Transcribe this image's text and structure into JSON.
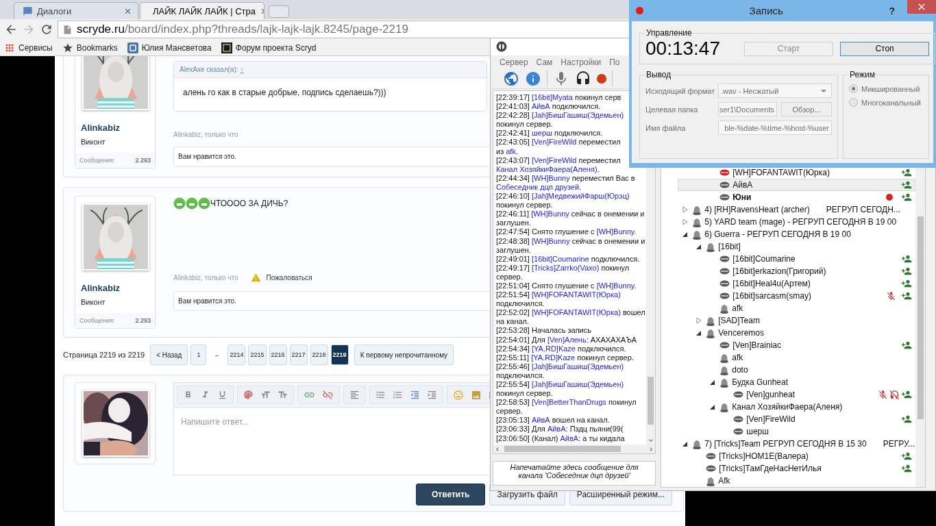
{
  "browser": {
    "tabs": [
      {
        "label": "Диалоги",
        "selected": false
      },
      {
        "label": "ЛАЙК ЛАЙК ЛАЙК | Стра",
        "selected": true
      }
    ],
    "address": {
      "host": "scryde.ru",
      "path": "/board/index.php?threads/lajk-lajk-lajk.8245/page-2219"
    },
    "bookmarks": [
      "Сервисы",
      "Bookmarks",
      "Юлия Мансветова",
      "Форум проекта Scryd"
    ]
  },
  "forum": {
    "posts": [
      {
        "author": "Alinkabiz",
        "rank": "Виконт",
        "stats_label": "Сообщения:",
        "stats_value": "2.293",
        "avatar": {
          "kind": "picture"
        },
        "quote": {
          "author": "AlexAxe сказал(а):",
          "link": "↑",
          "text": "алень го как в старые добрые, подпись сделаешь?)))"
        },
        "meta": "Alinkabiz, только что",
        "likes": "Вам нравится это."
      },
      {
        "author": "Alinkabiz",
        "rank": "Виконт",
        "stats_label": "Сообщения:",
        "stats_value": "2.293",
        "avatar": {
          "kind": "picture"
        },
        "text": "ЧТОООО ЗА ДИЧЬ?",
        "meta": "Alinkabiz, только что",
        "report": "Пожаловаться",
        "likes": "Вам нравится это."
      }
    ],
    "pagination": {
      "label": "Страница 2219 из 2219",
      "prev": "< Назад",
      "pages": [
        {
          "label": "1",
          "kind": "page",
          "selected": false
        },
        {
          "label": "←",
          "kind": "gap",
          "selected": false
        },
        {
          "label": "2214",
          "kind": "page",
          "selected": false
        },
        {
          "label": "2215",
          "kind": "page",
          "selected": false
        },
        {
          "label": "2216",
          "kind": "page",
          "selected": false
        },
        {
          "label": "2217",
          "kind": "page",
          "selected": false
        },
        {
          "label": "2218",
          "kind": "page",
          "selected": false
        },
        {
          "label": "2219",
          "kind": "page",
          "selected": true
        }
      ],
      "first_unread": "К первому непрочитанному"
    },
    "reply": {
      "avatar": {
        "kind": "picture"
      },
      "placeholder": "Напишите ответ...",
      "submit": "Ответить",
      "buttons": [
        "Загрузить файл",
        "Расширенный режим..."
      ]
    }
  },
  "teamspeak": {
    "menu": [
      "Сервер",
      "Сам",
      "Настройки",
      "По"
    ],
    "chat": {
      "lines": [
        {
          "parts": [
            {
              "kind": "time",
              "text": "[22:39:17] "
            },
            {
              "kind": "name",
              "text": "[16bit]Myata"
            },
            {
              "kind": "text",
              "text": " покинул серв"
            }
          ]
        },
        {
          "parts": [
            {
              "kind": "time",
              "text": "[22:41:03] "
            },
            {
              "kind": "name",
              "text": "АйвА"
            },
            {
              "kind": "text",
              "text": " подключился."
            }
          ]
        },
        {
          "parts": [
            {
              "kind": "time",
              "text": "[22:42:28] "
            },
            {
              "kind": "name",
              "text": "[Jah]БишГашиш(Эдемьен)"
            }
          ]
        },
        {
          "parts": [
            {
              "kind": "text",
              "text": "покинул сервер."
            }
          ]
        },
        {
          "parts": [
            {
              "kind": "time",
              "text": "[22:42:41] "
            },
            {
              "kind": "name",
              "text": "шерш"
            },
            {
              "kind": "text",
              "text": " подключился."
            }
          ]
        },
        {
          "parts": [
            {
              "kind": "time",
              "text": "[22:43:05] "
            },
            {
              "kind": "name",
              "text": "[Ven]FireWild"
            },
            {
              "kind": "text",
              "text": " переместил"
            }
          ]
        },
        {
          "parts": [
            {
              "kind": "text",
              "text": "из "
            },
            {
              "kind": "name",
              "text": "afk"
            },
            {
              "kind": "text",
              "text": "."
            }
          ]
        },
        {
          "parts": [
            {
              "kind": "time",
              "text": "[22:43:07] "
            },
            {
              "kind": "name",
              "text": "[Ven]FireWild"
            },
            {
              "kind": "text",
              "text": " переместил"
            }
          ]
        },
        {
          "parts": [
            {
              "kind": "name",
              "text": "Канал ХозяйкиФаера(Аленя)"
            },
            {
              "kind": "text",
              "text": "."
            }
          ]
        },
        {
          "parts": [
            {
              "kind": "time",
              "text": "[22:44:34] "
            },
            {
              "kind": "name",
              "text": "[WH]Bunny"
            },
            {
              "kind": "text",
              "text": " переместил Вас в"
            }
          ]
        },
        {
          "parts": [
            {
              "kind": "name",
              "text": "Собеседник дцп друзей"
            },
            {
              "kind": "text",
              "text": "."
            }
          ]
        },
        {
          "parts": [
            {
              "kind": "time",
              "text": "[22:46:10] "
            },
            {
              "kind": "name",
              "text": "[Jah]МедвежийФарш(Юрэц)"
            }
          ]
        },
        {
          "parts": [
            {
              "kind": "text",
              "text": "покинул сервер."
            }
          ]
        },
        {
          "parts": [
            {
              "kind": "time",
              "text": "[22:46:11] "
            },
            {
              "kind": "name",
              "text": "[WH]Bunny"
            },
            {
              "kind": "text",
              "text": " сейчас в онемении и"
            }
          ]
        },
        {
          "parts": [
            {
              "kind": "text",
              "text": "заглушен."
            }
          ]
        },
        {
          "parts": [
            {
              "kind": "time",
              "text": "[22:47:54] "
            },
            {
              "kind": "text",
              "text": "Снято глушение с "
            },
            {
              "kind": "name",
              "text": "[WH]Bunny"
            },
            {
              "kind": "text",
              "text": "."
            }
          ]
        },
        {
          "parts": [
            {
              "kind": "time",
              "text": "[22:48:38] "
            },
            {
              "kind": "name",
              "text": "[WH]Bunny"
            },
            {
              "kind": "text",
              "text": " сейчас в онемении и"
            }
          ]
        },
        {
          "parts": [
            {
              "kind": "text",
              "text": "заглушен."
            }
          ]
        },
        {
          "parts": [
            {
              "kind": "time",
              "text": "[22:49:01] "
            },
            {
              "kind": "name",
              "text": "[16bit]Coumarine"
            },
            {
              "kind": "text",
              "text": " подключился."
            }
          ]
        },
        {
          "parts": [
            {
              "kind": "time",
              "text": "[22:49:17] "
            },
            {
              "kind": "name",
              "text": "[Tricks]Zarrko(Vaxo)"
            },
            {
              "kind": "text",
              "text": " покинул"
            }
          ]
        },
        {
          "parts": [
            {
              "kind": "text",
              "text": "сервер."
            }
          ]
        },
        {
          "parts": [
            {
              "kind": "time",
              "text": "[22:51:04] "
            },
            {
              "kind": "text",
              "text": "Снято глушение с "
            },
            {
              "kind": "name",
              "text": "[WH]Bunny"
            },
            {
              "kind": "text",
              "text": "."
            }
          ]
        },
        {
          "parts": [
            {
              "kind": "time",
              "text": "[22:51:54] "
            },
            {
              "kind": "name",
              "text": "[WH]FOFANTAWIT(Юрка)"
            }
          ]
        },
        {
          "parts": [
            {
              "kind": "text",
              "text": "подключился."
            }
          ]
        },
        {
          "parts": [
            {
              "kind": "time",
              "text": "[22:52:02] "
            },
            {
              "kind": "name",
              "text": "[WH]FOFANTAWIT(Юрка)"
            },
            {
              "kind": "text",
              "text": " вошел"
            }
          ]
        },
        {
          "parts": [
            {
              "kind": "text",
              "text": "на канал."
            }
          ]
        },
        {
          "parts": [
            {
              "kind": "time",
              "text": "[22:53:28] "
            },
            {
              "kind": "text",
              "text": "Началась запись"
            }
          ]
        },
        {
          "parts": [
            {
              "kind": "time",
              "text": "[22:54:01] "
            },
            {
              "kind": "text",
              "text": "Для "
            },
            {
              "kind": "name",
              "text": "[Ven]Алень"
            },
            {
              "kind": "text",
              "text": ": АХАХАХАЪА"
            }
          ]
        },
        {
          "parts": [
            {
              "kind": "time",
              "text": "[22:54:34] "
            },
            {
              "kind": "name",
              "text": "[YA.RD]Kaze"
            },
            {
              "kind": "text",
              "text": " подключился."
            }
          ]
        },
        {
          "parts": [
            {
              "kind": "time",
              "text": "[22:55:11] "
            },
            {
              "kind": "name",
              "text": "[YA.RD]Kaze"
            },
            {
              "kind": "text",
              "text": " покинул сервер."
            }
          ]
        },
        {
          "parts": [
            {
              "kind": "time",
              "text": "[22:55:46] "
            },
            {
              "kind": "name",
              "text": "[Jah]БишГашиш(Эдемьен)"
            }
          ]
        },
        {
          "parts": [
            {
              "kind": "text",
              "text": "подключился."
            }
          ]
        },
        {
          "parts": [
            {
              "kind": "time",
              "text": "[22:55:54] "
            },
            {
              "kind": "name",
              "text": "[Jah]БишГашиш(Эдемьен)"
            }
          ]
        },
        {
          "parts": [
            {
              "kind": "text",
              "text": "покинул сервер."
            }
          ]
        },
        {
          "parts": [
            {
              "kind": "time",
              "text": "[22:58:53] "
            },
            {
              "kind": "name",
              "text": "[Ven]BetterThanDrugs"
            },
            {
              "kind": "text",
              "text": " покинул"
            }
          ]
        },
        {
          "parts": [
            {
              "kind": "text",
              "text": "сервер."
            }
          ]
        },
        {
          "parts": [
            {
              "kind": "time",
              "text": "[23:05:13] "
            },
            {
              "kind": "name",
              "text": "АйвА"
            },
            {
              "kind": "text",
              "text": " вошел на канал."
            }
          ]
        },
        {
          "parts": [
            {
              "kind": "time",
              "text": "[23:06:33] "
            },
            {
              "kind": "text",
              "text": "Для "
            },
            {
              "kind": "name",
              "text": "АйвА"
            },
            {
              "kind": "text",
              "text": ": Пздц пьяни(99("
            }
          ]
        },
        {
          "parts": [
            {
              "kind": "time",
              "text": "[23:06:50] "
            },
            {
              "kind": "text",
              "text": "(Канал) "
            },
            {
              "kind": "name",
              "text": "АйвА"
            },
            {
              "kind": "text",
              "text": ": а ты кидала"
            }
          ]
        }
      ],
      "input_hint": "Напечатайте здесь сообщение для канала 'Собеседник дцп друзей'"
    },
    "tree": {
      "top_users": [
        {
          "kind": "user",
          "label": "[WH]FOFANTAWIT(Юрка)",
          "selected": false,
          "self": false,
          "talking": true,
          "talk_power": true,
          "mic_muted": false,
          "sound_muted": false,
          "recording": false
        },
        {
          "kind": "user",
          "label": "АйвА",
          "selected": true,
          "self": false,
          "talking": false,
          "talk_power": true,
          "mic_muted": false,
          "sound_muted": false,
          "recording": false
        },
        {
          "kind": "user",
          "label": "Юни",
          "selected": false,
          "self": true,
          "talking": false,
          "talk_power": true,
          "mic_muted": false,
          "sound_muted": false,
          "recording": true
        }
      ],
      "items": [
        {
          "kind": "channel",
          "label": "4) [RH]RavensHeart (archer)",
          "topic": "РЕГРУП СЕГОДН...",
          "selected": false,
          "expanded": false
        },
        {
          "kind": "channel",
          "label": "5) YARD team (mage) -  РЕГРУП СЕГОДНЯ В 19 00",
          "selected": false,
          "expanded": false
        },
        {
          "kind": "channel",
          "label": "6) Guerra - РЕГРУП СЕГОДНЯ В 19 00",
          "selected": false,
          "expanded": true,
          "children": [
            {
              "kind": "channel",
              "label": "[16bit]",
              "selected": false,
              "expanded": true,
              "children": [
                {
                  "kind": "user",
                  "label": "[16bit]Coumarine",
                  "selected": false,
                  "self": false,
                  "talking": false,
                  "talk_power": true,
                  "mic_muted": false,
                  "sound_muted": false,
                  "recording": false
                },
                {
                  "kind": "user",
                  "label": "[16bit]erkazion(Григорий)",
                  "selected": false,
                  "self": false,
                  "talking": false,
                  "talk_power": true,
                  "mic_muted": false,
                  "sound_muted": false,
                  "recording": false
                },
                {
                  "kind": "user",
                  "label": "[16bit]Heal4u(Артем)",
                  "selected": false,
                  "self": false,
                  "talking": false,
                  "talk_power": true,
                  "mic_muted": false,
                  "sound_muted": false,
                  "recording": false
                },
                {
                  "kind": "user",
                  "label": "[16bit]sarcasm(smay)",
                  "selected": false,
                  "self": false,
                  "talking": false,
                  "talk_power": true,
                  "mic_muted": true,
                  "sound_muted": false,
                  "recording": false
                },
                {
                  "kind": "channel",
                  "label": "afk",
                  "selected": false
                }
              ]
            },
            {
              "kind": "channel",
              "label": "[SAD]Team",
              "selected": false,
              "expanded": false
            },
            {
              "kind": "channel",
              "label": "Venceremos",
              "selected": false,
              "expanded": true,
              "children": [
                {
                  "kind": "user",
                  "label": "[Ven]Brainiac",
                  "selected": false,
                  "self": false,
                  "talking": false,
                  "talk_power": true,
                  "mic_muted": false,
                  "sound_muted": false,
                  "recording": false
                },
                {
                  "kind": "channel",
                  "label": "afk",
                  "selected": false
                },
                {
                  "kind": "channel",
                  "label": "doto",
                  "selected": false
                },
                {
                  "kind": "channel",
                  "label": "Будка Gunheat",
                  "selected": false,
                  "expanded": true,
                  "children": [
                    {
                      "kind": "user",
                      "label": "[Ven]gunheat",
                      "selected": false,
                      "self": false,
                      "talking": false,
                      "talk_power": true,
                      "mic_muted": true,
                      "sound_muted": true,
                      "recording": false
                    }
                  ]
                },
                {
                  "kind": "channel",
                  "label": "Канал ХозяйкиФаера(Аленя)",
                  "selected": false,
                  "expanded": true,
                  "children": [
                    {
                      "kind": "user",
                      "label": "[Ven]FireWild",
                      "selected": false,
                      "self": false,
                      "talking": false,
                      "talk_power": true,
                      "mic_muted": false,
                      "sound_muted": false,
                      "recording": false
                    },
                    {
                      "kind": "user",
                      "label": "шерш",
                      "selected": false,
                      "self": false,
                      "talking": false,
                      "talk_power": false,
                      "mic_muted": false,
                      "sound_muted": false,
                      "recording": false
                    }
                  ]
                }
              ]
            }
          ]
        },
        {
          "kind": "channel",
          "label": "7) [Tricks]Team РЕГРУП СЕГОДНЯ В 15 30",
          "topic": "РЕГРУ...",
          "selected": false,
          "expanded": true,
          "children": [
            {
              "kind": "user",
              "label": "[Tricks]HOM1E(Валера)",
              "selected": false,
              "self": false,
              "talking": false,
              "talk_power": true,
              "mic_muted": false,
              "sound_muted": false,
              "recording": false
            },
            {
              "kind": "user",
              "label": "[Tricks]ТамГдеНасНетИлья",
              "selected": false,
              "self": false,
              "talking": false,
              "talk_power": true,
              "mic_muted": false,
              "sound_muted": false,
              "recording": false
            },
            {
              "kind": "channel",
              "label": "Afk",
              "selected": false
            }
          ]
        }
      ]
    }
  },
  "recorder": {
    "title": "Запись",
    "help": "?",
    "control": {
      "legend": "Управление",
      "time": "00:13:47",
      "buttons": [
        {
          "label": "Старт",
          "disabled": true
        },
        {
          "label": "Стоп",
          "disabled": false
        }
      ]
    },
    "output": {
      "legend": "Вывод",
      "fields": [
        {
          "kind": "select",
          "label": "Исходящий формат",
          "value": ".wav - Несжатый"
        },
        {
          "kind": "path",
          "label": "Целевая папка",
          "value": "ser1\\Documents",
          "button": "Обзор..."
        },
        {
          "kind": "text",
          "label": "Имя файла",
          "value": "ble-%date-%time-%host-%user"
        }
      ]
    },
    "mode": {
      "legend": "Режим",
      "options": [
        {
          "label": "Микшированный",
          "selected": true
        },
        {
          "label": "Многоканальный",
          "selected": false
        }
      ]
    }
  }
}
